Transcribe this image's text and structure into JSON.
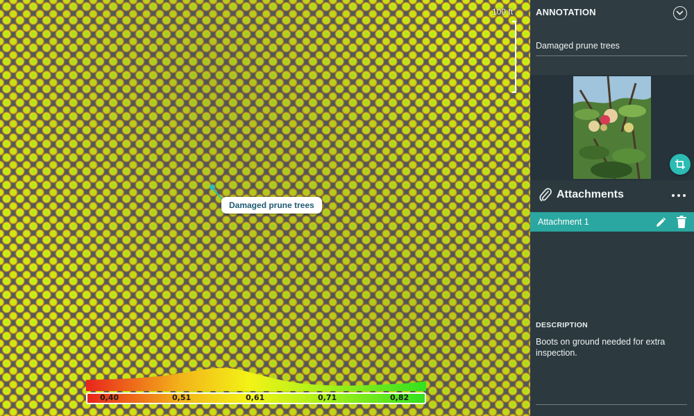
{
  "map": {
    "scale_label": "100 ft",
    "annotation_label": "Damaged prune trees",
    "legend": {
      "ticks": [
        "0,40",
        "0,51",
        "0,61",
        "0,71",
        "0,82"
      ],
      "colors": {
        "low": "#e8241b",
        "mid": "#f3f316",
        "high": "#31e01f"
      }
    }
  },
  "panel": {
    "heading": "ANNOTATION",
    "annotation_name": "Damaged prune trees",
    "attachments": {
      "title": "Attachments",
      "items": [
        {
          "label": "Attachment 1"
        }
      ]
    },
    "description": {
      "heading": "DESCRIPTION",
      "text": "Boots on ground needed for extra inspection."
    },
    "icons": [
      "chevron-down-icon",
      "crop-icon",
      "paperclip-icon",
      "more-options-icon",
      "pencil-icon",
      "trash-icon"
    ],
    "accent_color": "#2bbcb4"
  }
}
